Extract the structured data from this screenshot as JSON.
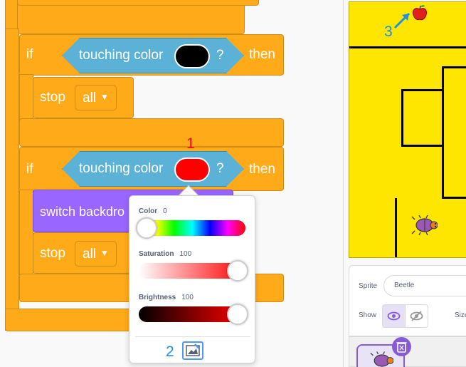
{
  "blocks": {
    "if_1": {
      "if_label": "if",
      "condition_label": "touching color",
      "question": "?",
      "then_label": "then",
      "swatch_color": "#000000"
    },
    "stop_1": {
      "label": "stop",
      "option": "all"
    },
    "if_2": {
      "if_label": "if",
      "condition_label": "touching color",
      "question": "?",
      "then_label": "then",
      "swatch_color": "#ff0000"
    },
    "switch": {
      "label": "switch backdro"
    },
    "stop_2": {
      "label": "stop",
      "option": "all"
    }
  },
  "annotations": {
    "one": "1",
    "two": "2",
    "three": "3",
    "red": "#ff0000",
    "blue": "#1e90e6"
  },
  "color_picker": {
    "color_label": "Color",
    "color_value": "0",
    "saturation_label": "Saturation",
    "saturation_value": "100",
    "brightness_label": "Brightness",
    "brightness_value": "100",
    "color_fraction": 0.0,
    "saturation_fraction": 1.0,
    "brightness_fraction": 1.0
  },
  "sprite_info": {
    "sprite_label": "Sprite",
    "sprite_name": "Beetle",
    "show_label": "Show",
    "size_label": "Size"
  },
  "colors": {
    "block_orange": "#ffab19",
    "sensing_blue": "#5cb1d6",
    "looks_purple": "#9966ff",
    "stage_yellow": "#ffe600"
  }
}
